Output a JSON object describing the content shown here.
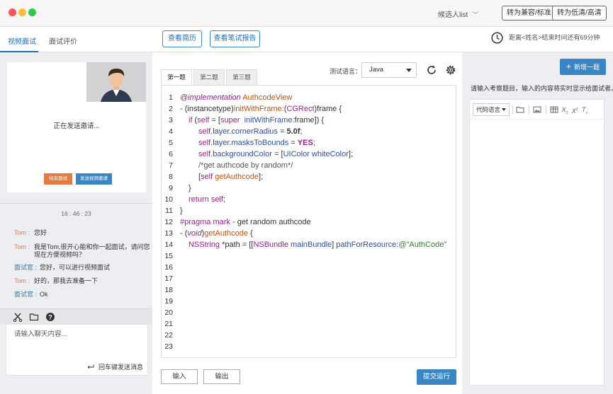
{
  "titlebar": {
    "candidate_list": "候选人list",
    "btn_compat": "转为兼容/标准",
    "btn_quality": "转为低清/高清"
  },
  "left": {
    "tabs": [
      "视频面试",
      "面试评价"
    ],
    "video_status": "正在发送邀请...",
    "btn_end": "结束面试",
    "btn_invite": "发送视频邀请",
    "chat_time": "16 : 46 : 23",
    "messages": [
      {
        "who": "Tom :",
        "text": "您好"
      },
      {
        "who": "Tom :",
        "text": "我是Tom,很开心能和你一起面试，请问您",
        "text2": "现在方便视频吗？"
      },
      {
        "who": "面试官 :",
        "text": "您好，可以进行视频面试"
      },
      {
        "who": "Tom :",
        "text": "好的，那我去准备一下"
      },
      {
        "who": "面试官 :",
        "text": "Ok"
      }
    ],
    "chat_placeholder": "请输入聊天内容...",
    "send_hint": "回车键发送消息"
  },
  "topbar": {
    "btn_resume": "查看简历",
    "btn_report": "查看笔试报告",
    "timer_text": "距离<姓名>结束时间还有69分钟"
  },
  "editor": {
    "tabs": [
      "第一题",
      "第二题",
      "第三题"
    ],
    "lang_label": "测试语言：",
    "lang_value": "Java",
    "line_numbers": [
      "1",
      "2",
      "3",
      "4",
      "5",
      "6",
      "7",
      "8",
      "9",
      "10",
      "11",
      "12",
      "13",
      "14",
      "15",
      "16",
      "17",
      "18",
      "19",
      "20",
      "21",
      "22",
      "23"
    ],
    "btn_input": "输入",
    "btn_output": "输出",
    "btn_submit": "提交运行"
  },
  "right": {
    "add_btn": "新增一题",
    "hint": "请输入考察题目，输入的内容将实时显示给面试者。",
    "code_lang_select": "代码语言"
  }
}
